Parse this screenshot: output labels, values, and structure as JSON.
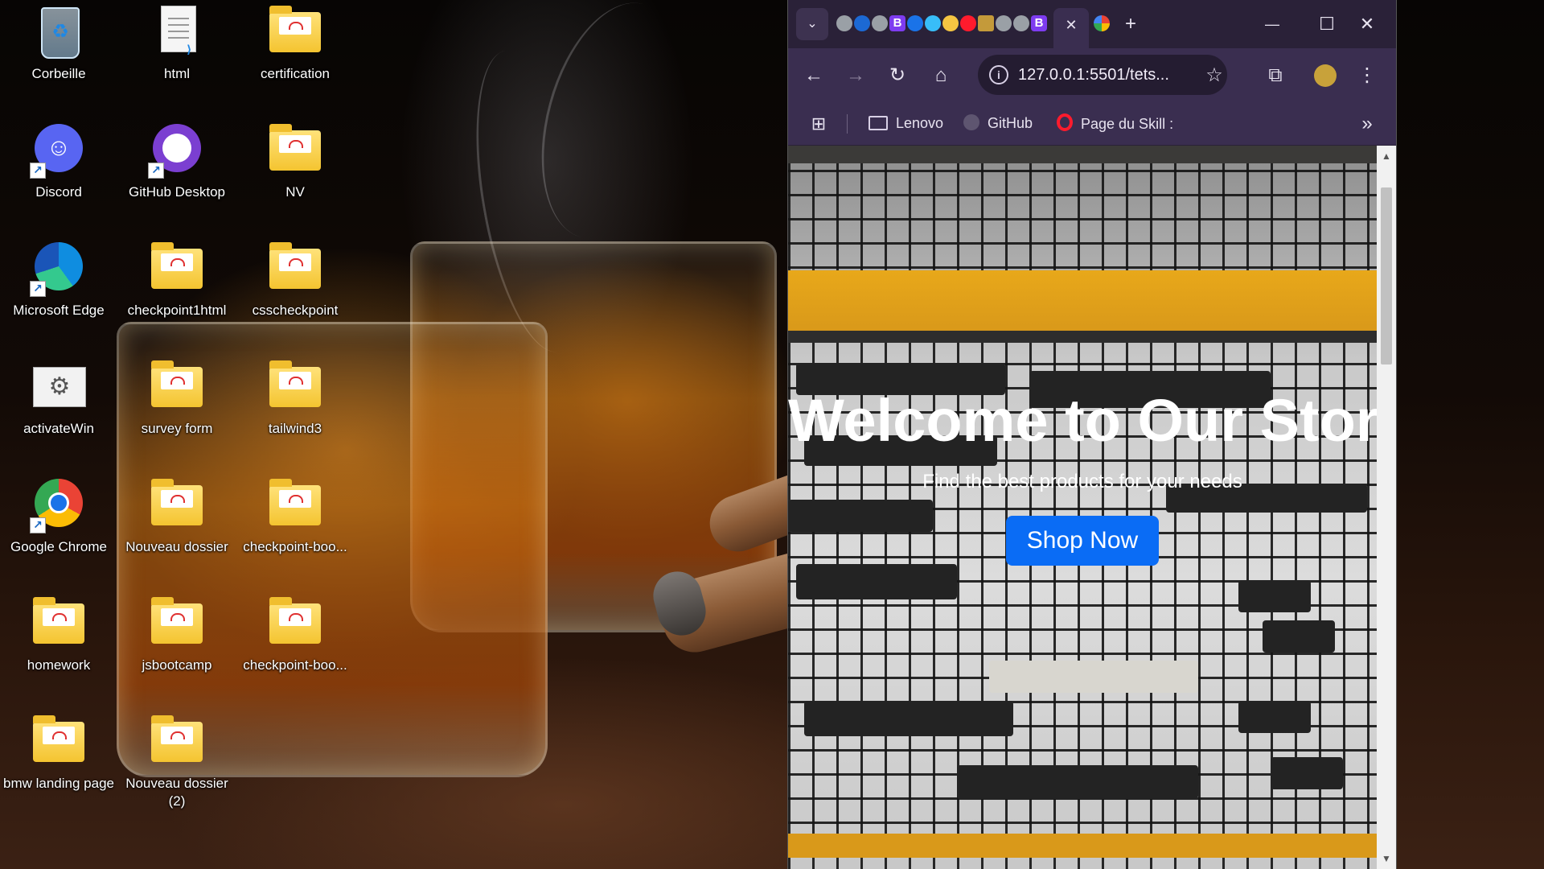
{
  "desktop": {
    "icons": [
      {
        "label": "Corbeille",
        "icon": "recycle-bin-icon"
      },
      {
        "label": "html",
        "icon": "file-icon"
      },
      {
        "label": "certification",
        "icon": "folder-icon"
      },
      {
        "label": "Discord",
        "icon": "discord-icon"
      },
      {
        "label": "GitHub Desktop",
        "icon": "github-desktop-icon"
      },
      {
        "label": "NV",
        "icon": "folder-icon"
      },
      {
        "label": "Microsoft Edge",
        "icon": "edge-icon"
      },
      {
        "label": "checkpoint1html",
        "icon": "folder-icon"
      },
      {
        "label": "csscheckpoint",
        "icon": "folder-icon"
      },
      {
        "label": "activateWin",
        "icon": "settings-app-icon"
      },
      {
        "label": "survey form",
        "icon": "folder-icon"
      },
      {
        "label": "tailwind3",
        "icon": "folder-icon"
      },
      {
        "label": "Google Chrome",
        "icon": "chrome-icon"
      },
      {
        "label": "Nouveau dossier",
        "icon": "folder-icon"
      },
      {
        "label": "checkpoint-boo...",
        "icon": "folder-icon"
      },
      {
        "label": "homework",
        "icon": "folder-icon"
      },
      {
        "label": "jsbootcamp",
        "icon": "folder-icon"
      },
      {
        "label": "checkpoint-boo...",
        "icon": "folder-icon"
      },
      {
        "label": "bmw landing page",
        "icon": "folder-icon"
      },
      {
        "label": "Nouveau dossier (2)",
        "icon": "folder-icon"
      }
    ]
  },
  "browser": {
    "tab_close": "✕",
    "new_tab": "+",
    "window_controls": {
      "minimize": "—",
      "maximize": "☐",
      "close": "✕"
    },
    "address": "127.0.0.1:5501/tets...",
    "bookmarks": [
      {
        "label": "Lenovo",
        "icon": "folder-icon"
      },
      {
        "label": "GitHub",
        "icon": "github-icon"
      },
      {
        "label": "Page du Skill :",
        "icon": "opera-icon"
      }
    ],
    "bookmarks_more": "»"
  },
  "page": {
    "hero_title": "Welcome to Our Store",
    "hero_subtitle": "Find the best products for your needs",
    "hero_button": "Shop Now"
  },
  "colors": {
    "button_blue": "#0a6cf5",
    "browser_frame": "#35294a"
  }
}
